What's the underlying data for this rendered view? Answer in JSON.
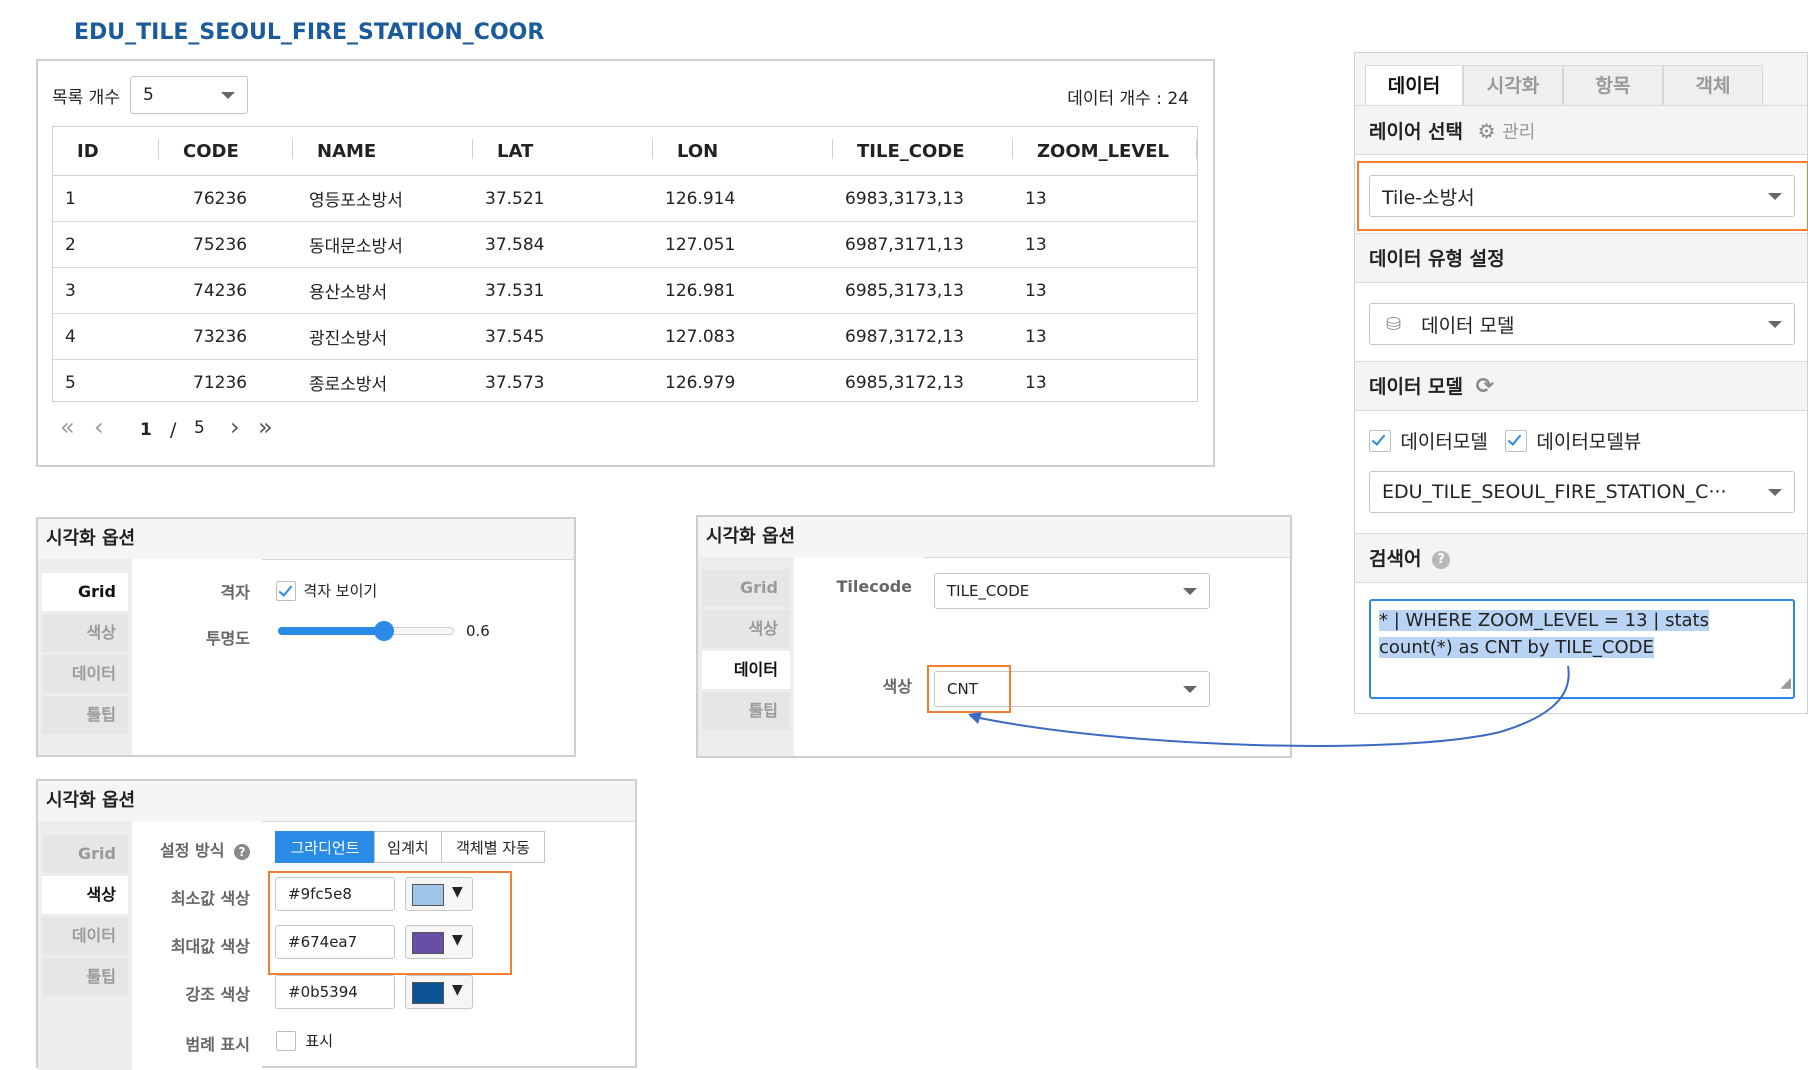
{
  "page_title": "EDU_TILE_SEOUL_FIRE_STATION_COOR",
  "table_panel": {
    "list_count_label": "목록 개수",
    "list_count_value": "5",
    "data_count_text": "데이터 개수 : 24",
    "columns": [
      "ID",
      "CODE",
      "NAME",
      "LAT",
      "LON",
      "TILE_CODE",
      "ZOOM_LEVEL"
    ],
    "rows": [
      [
        "1",
        "76236",
        "영등포소방서",
        "37.521",
        "126.914",
        "6983,3173,13",
        "13"
      ],
      [
        "2",
        "75236",
        "동대문소방서",
        "37.584",
        "127.051",
        "6987,3171,13",
        "13"
      ],
      [
        "3",
        "74236",
        "용산소방서",
        "37.531",
        "126.981",
        "6985,3173,13",
        "13"
      ],
      [
        "4",
        "73236",
        "광진소방서",
        "37.545",
        "127.083",
        "6987,3172,13",
        "13"
      ],
      [
        "5",
        "71236",
        "종로소방서",
        "37.573",
        "126.979",
        "6985,3172,13",
        "13"
      ]
    ],
    "pagination": {
      "current": "1",
      "separator": "/",
      "total": "5"
    }
  },
  "viz_grid": {
    "title": "시각화 옵션",
    "tabs": [
      "Grid",
      "색상",
      "데이터",
      "툴팁"
    ],
    "grid_label": "격자",
    "grid_checkbox_label": "격자 보이기",
    "grid_checked": true,
    "opacity_label": "투명도",
    "opacity_value": "0.6",
    "opacity_fraction": 0.6
  },
  "viz_data": {
    "title": "시각화 옵션",
    "tabs": [
      "Grid",
      "색상",
      "데이터",
      "툴팁"
    ],
    "tilecode_label": "Tilecode",
    "tilecode_value": "TILE_CODE",
    "color_label": "색상",
    "color_value": "CNT"
  },
  "viz_color": {
    "title": "시각화 옵션",
    "tabs": [
      "Grid",
      "색상",
      "데이터",
      "툴팁"
    ],
    "method_label": "설정 방식",
    "methods": [
      "그라디언트",
      "임계치",
      "객체별 자동"
    ],
    "min_label": "최소값 색상",
    "min_value": "#9fc5e8",
    "max_label": "최대값 색상",
    "max_value": "#674ea7",
    "accent_label": "강조 색상",
    "accent_value": "#0b5394",
    "legend_label": "범례 표시",
    "legend_checkbox_label": "표시",
    "legend_checked": false
  },
  "right_panel": {
    "tabs": [
      "데이터",
      "시각화",
      "항목",
      "객체"
    ],
    "layer_select_label": "레이어 선택",
    "manage_label": "관리",
    "layer_value": "Tile-소방서",
    "data_type_label": "데이터 유형 설정",
    "data_type_value": "데이터 모델",
    "data_model_label": "데이터 모델",
    "cb_model_label": "데이터모델",
    "cb_model_view_label": "데이터모델뷰",
    "model_value": "EDU_TILE_SEOUL_FIRE_STATION_C···",
    "search_label": "검색어",
    "query_line1": "* |  WHERE  ZOOM_LEVEL = 13 | stats",
    "query_line2": "count(*) as CNT by TILE_CODE"
  },
  "colors": {
    "accent_blue": "#2a8be6",
    "highlight_orange": "#f07f34",
    "title_blue": "#1b5a9b",
    "selection": "#b8d3f3"
  }
}
